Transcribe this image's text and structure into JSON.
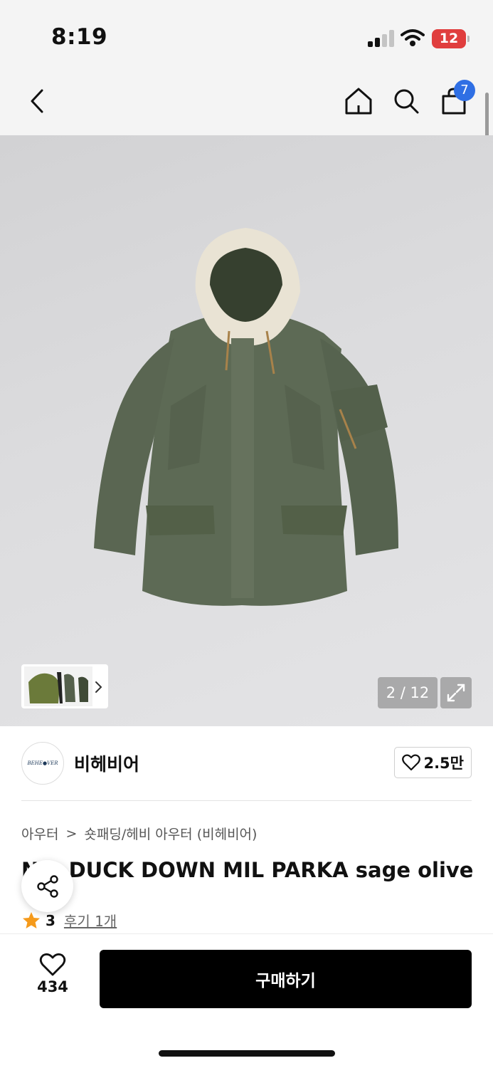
{
  "status_bar": {
    "time": "8:19",
    "battery": "12",
    "battery_color": "#e03e3e"
  },
  "nav": {
    "back_icon": "chevron-left-icon",
    "home_icon": "home-icon",
    "search_icon": "search-icon",
    "cart_icon": "shopping-bag-icon",
    "cart_count": "7",
    "badge_color": "#2f6fe4"
  },
  "gallery": {
    "counter": "2 / 12",
    "current_index": 2,
    "total": 12,
    "expand_icon": "expand-icon",
    "thumb_next_icon": "chevron-right-icon"
  },
  "brand": {
    "logo_text": "BEHE●VER",
    "name": "비헤비어",
    "likes": "2.5만"
  },
  "breadcrumb": {
    "category": "아우터",
    "separator": ">",
    "subcategory": "숏패딩/헤비 아우터 (비헤비어)"
  },
  "product": {
    "title": "N-3 DUCK DOWN MIL PARKA sage olive",
    "rating": "3",
    "review_link": "후기 1개"
  },
  "bottom_bar": {
    "wish_count": "434",
    "buy_label": "구매하기"
  }
}
